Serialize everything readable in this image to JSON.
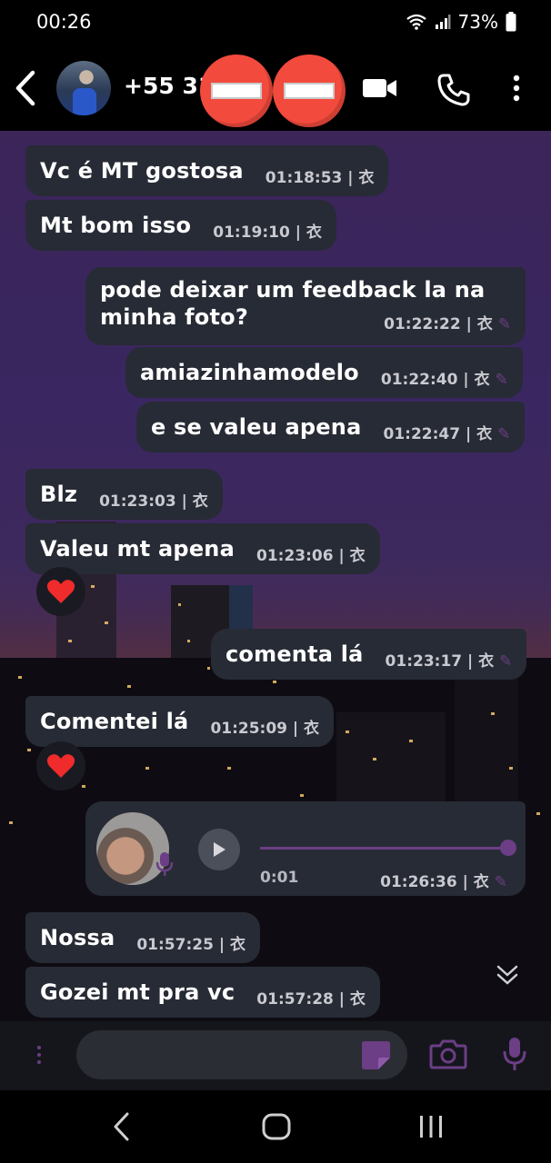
{
  "status_bar": {
    "time": "00:26",
    "battery": "73%"
  },
  "header": {
    "contact_name": "+55 31"
  },
  "messages": [
    {
      "dir": "in",
      "text": "Vc é MT gostosa",
      "time": "01:18:53 | 衣"
    },
    {
      "dir": "in",
      "text": "Mt bom isso",
      "time": "01:19:10 | 衣"
    },
    {
      "dir": "out",
      "text_line1": "pode deixar um feedback la na",
      "text_line2": "minha foto?",
      "time": "01:22:22 | 衣"
    },
    {
      "dir": "out",
      "text": "amiazinhamodelo",
      "time": "01:22:40 | 衣"
    },
    {
      "dir": "out",
      "text": "e se valeu apena",
      "time": "01:22:47 | 衣"
    },
    {
      "dir": "in",
      "text": "Blz",
      "time": "01:23:03 | 衣"
    },
    {
      "dir": "in",
      "text": "Valeu mt apena",
      "time": "01:23:06 | 衣",
      "reaction": "❤️"
    },
    {
      "dir": "out",
      "text": "comenta lá",
      "time": "01:23:17 | 衣"
    },
    {
      "dir": "in",
      "text": "Comentei lá",
      "time": "01:25:09 | 衣",
      "reaction": "❤️"
    },
    {
      "dir": "out",
      "type": "voice",
      "duration": "0:01",
      "time": "01:26:36 | 衣"
    },
    {
      "dir": "in",
      "text": "Nossa",
      "time": "01:57:25 | 衣"
    },
    {
      "dir": "in",
      "text": "Gozei mt pra vc",
      "time": "01:57:28 | 衣"
    }
  ],
  "colors": {
    "accent": "#6b3e85",
    "bubble": "#272b35",
    "redaction": "#f24a3d"
  }
}
